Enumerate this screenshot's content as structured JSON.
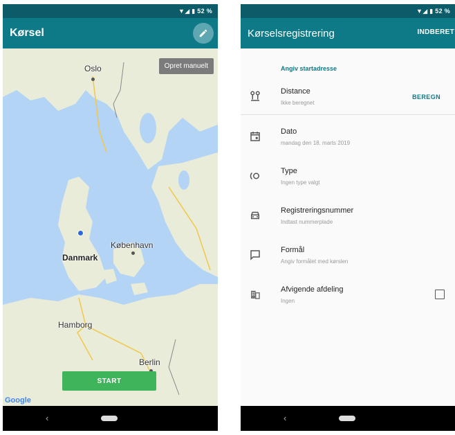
{
  "left": {
    "status": "▼◢ ▮ 52 %",
    "title": "Kørsel",
    "manual_button": "Opret manuelt",
    "start_button": "START",
    "cities": {
      "oslo": "Oslo",
      "denmark": "Danmark",
      "copenhagen": "København",
      "hamburg": "Hamborg",
      "berlin": "Berlin"
    },
    "google": "Google",
    "nav_back": "‹"
  },
  "right": {
    "status": "▼◢ ▮ 52 %",
    "title": "Kørselsregistrering",
    "submit": "INDBERET",
    "start_address": "Angiv startadresse",
    "rows": [
      {
        "label": "Distance",
        "sub": "Ikke beregnet",
        "action": "BEREGN",
        "icon": "distance-icon"
      },
      {
        "label": "Dato",
        "sub": "mandag den 18. marts 2019",
        "icon": "calendar-icon"
      },
      {
        "label": "Type",
        "sub": "Ingen type valgt",
        "icon": "type-icon"
      },
      {
        "label": "Registreringsnummer",
        "sub": "Indtast nummerplade",
        "icon": "car-icon"
      },
      {
        "label": "Formål",
        "sub": "Angiv formålet med kørslen",
        "icon": "message-icon"
      },
      {
        "label": "Afvigende afdeling",
        "sub": "Ingen",
        "icon": "building-icon"
      }
    ],
    "nav_back": "‹"
  },
  "colors": {
    "status_bar": "#0b5b69",
    "app_bar": "#0e7a88",
    "accent": "#0e7a88",
    "start_button": "#3fb45b",
    "water": "#b3d4f5",
    "land": "#e9ecd9"
  }
}
